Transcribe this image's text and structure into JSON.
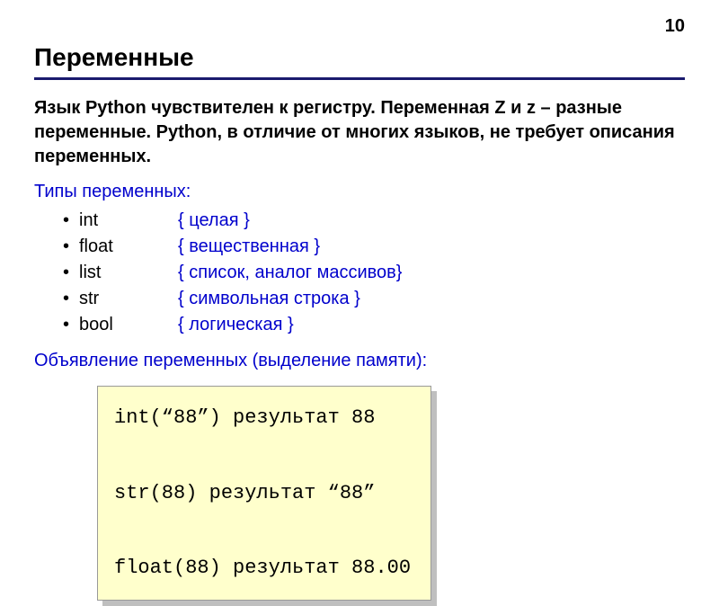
{
  "page_number": "10",
  "title": "Переменные",
  "intro": "Язык Python чувствителен к регистру. Переменная Z и z – разные переменные. Python, в отличие от многих языков, не требует описания переменных.",
  "types_header": "Типы переменных:",
  "types": [
    {
      "name": "int",
      "desc": "{ целая }"
    },
    {
      "name": "float",
      "desc": "{ вещественная }"
    },
    {
      "name": "list",
      "desc": "{ список, аналог массивов}"
    },
    {
      "name": "str",
      "desc": "{ символьная строка }"
    },
    {
      "name": "bool",
      "desc": "{ логическая }"
    }
  ],
  "decl_header": "Объявление переменных (выделение памяти):",
  "code": {
    "line1": "int(“88”) результат 88",
    "line2": "str(88) результат “88”",
    "line3": "float(88) результат 88.00"
  }
}
